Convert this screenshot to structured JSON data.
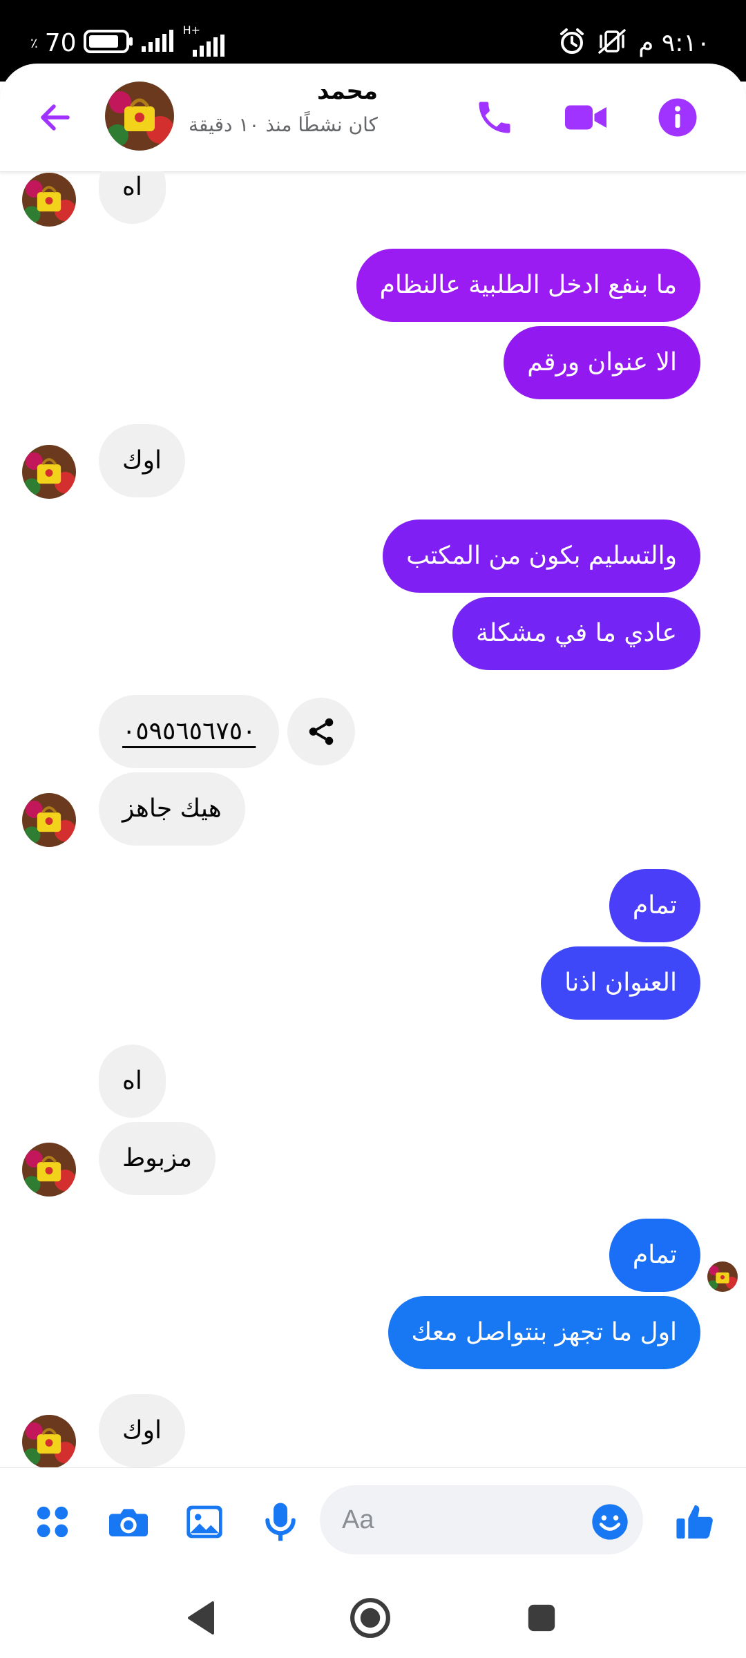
{
  "status_bar": {
    "time": "٩:١٠ م",
    "battery": "70",
    "battery_unit": "٪",
    "network": "H+"
  },
  "header": {
    "contact_name": "محمد",
    "contact_status": "كان نشطًا منذ ١٠ دقيقة",
    "icons": [
      "back-arrow-icon",
      "phone-icon",
      "video-camera-icon",
      "info-icon"
    ],
    "accent_color": "#a033ff"
  },
  "messages": [
    {
      "dir": "in",
      "text": "اه",
      "color": "#f0f0f0"
    },
    {
      "dir": "out",
      "text": "ما بنفع ادخل الطلبية عالنظام",
      "color": "#9b1cf2"
    },
    {
      "dir": "out",
      "text": "الا عنوان ورقم",
      "color": "#9219f0"
    },
    {
      "dir": "in",
      "text": "اوك",
      "color": "#f0f0f0"
    },
    {
      "dir": "out",
      "text": "والتسليم بكون من المكتب",
      "color": "#7f1ff4"
    },
    {
      "dir": "out",
      "text": "عادي ما في مشكلة",
      "color": "#7424f5"
    },
    {
      "dir": "in",
      "text": "٠٥٩٥٦٥٦٧٥٠",
      "color": "#f0f0f0"
    },
    {
      "dir": "in",
      "text": "هيك جاهز",
      "color": "#f0f0f0"
    },
    {
      "dir": "out",
      "text": "تمام",
      "color": "#4a3ef8"
    },
    {
      "dir": "out",
      "text": "العنوان اذنا",
      "color": "#3e48f8"
    },
    {
      "dir": "in",
      "text": "اه",
      "color": "#f0f0f0"
    },
    {
      "dir": "in",
      "text": "مزبوط",
      "color": "#f0f0f0"
    },
    {
      "dir": "out",
      "text": "تمام",
      "color": "#1b6ff7"
    },
    {
      "dir": "out",
      "text": "اول ما تجهز بنتواصل معك",
      "color": "#1877f2"
    },
    {
      "dir": "in",
      "text": "اوك",
      "color": "#f0f0f0"
    }
  ],
  "composer": {
    "placeholder": "Aa",
    "icons": [
      "apps-icon",
      "camera-icon",
      "gallery-icon",
      "microphone-icon",
      "emoji-icon",
      "thumbs-up-icon"
    ],
    "accent_color": "#1877f2"
  },
  "nav": {
    "icons": [
      "back-triangle-icon",
      "home-circle-icon",
      "recents-square-icon"
    ]
  }
}
